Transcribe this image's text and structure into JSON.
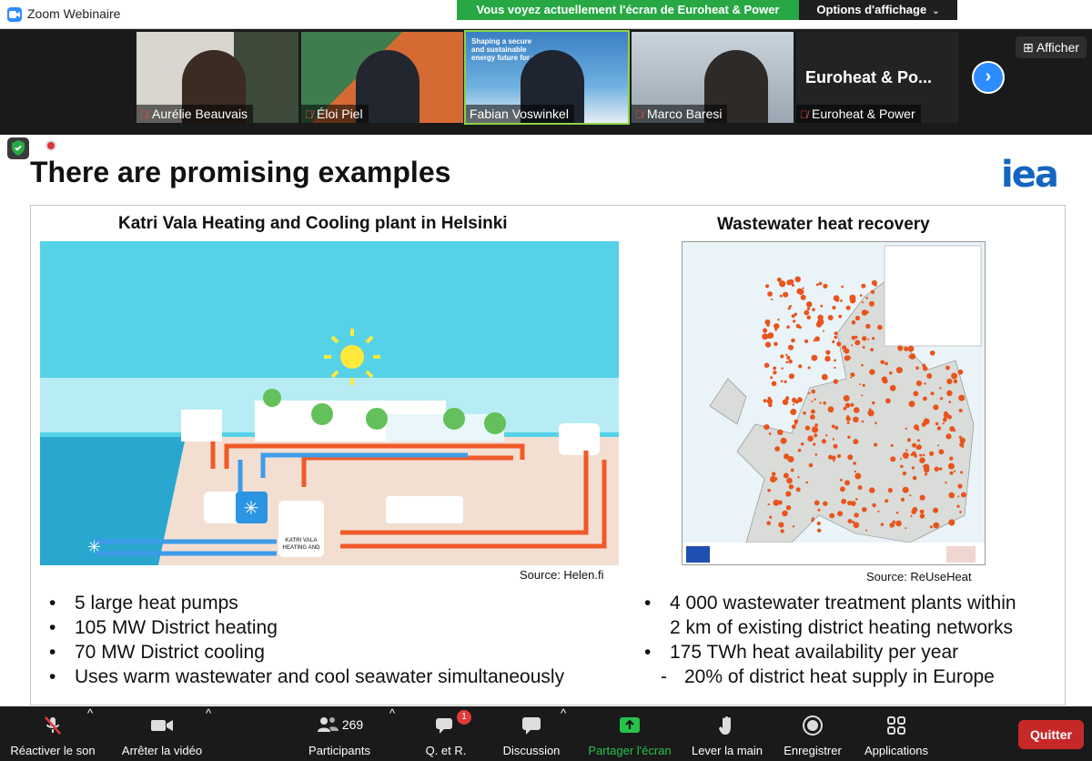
{
  "window": {
    "title": "Zoom Webinaire",
    "share_banner": "Vous voyez actuellement l'écran de Euroheat & Power",
    "view_options": "Options d'affichage"
  },
  "participants_strip": {
    "tiles": [
      {
        "name": "Aurélie Beauvais",
        "muted": true
      },
      {
        "name": "Éloi Piel",
        "muted": true
      },
      {
        "name": "Fabian Voswinkel",
        "muted": false,
        "background_text": "Shaping a secure and sustainable energy future for all."
      },
      {
        "name": "Marco Baresi",
        "muted": true
      },
      {
        "name": "Euroheat & Power",
        "muted": true,
        "display": "Euroheat & Po..."
      }
    ],
    "next_label": "›",
    "show_button": "Afficher"
  },
  "slide": {
    "title": "There are promising examples",
    "logo": "iea",
    "left": {
      "heading": "Katri Vala Heating and Cooling plant in Helsinki",
      "source": "Source: Helen.fi",
      "plant_label": "KATRI VALA HEATING AND COOLING PLANT",
      "bullets": [
        "5 large heat pumps",
        "105 MW District heating",
        "70 MW District cooling",
        "Uses warm wastewater and cool seawater simultaneously"
      ]
    },
    "right": {
      "heading": "Wastewater heat recovery",
      "source": "Source: ReUseHeat",
      "bullets": [
        {
          "text": "4 000 wastewater treatment plants within",
          "type": "bullet"
        },
        {
          "text": "2 km of existing district heating networks",
          "type": "cont"
        },
        {
          "text": "175 TWh heat availability per year",
          "type": "bullet"
        },
        {
          "text": "20% of district heat supply in Europe",
          "type": "sub"
        }
      ]
    }
  },
  "toolbar": {
    "unmute": "Réactiver le son",
    "stop_video": "Arrêter la vidéo",
    "participants": "Participants",
    "participants_count": "269",
    "qa": "Q. et R.",
    "qa_badge": "1",
    "discussion": "Discussion",
    "share_screen": "Partager l'écran",
    "raise_hand": "Lever la main",
    "record": "Enregistrer",
    "apps": "Applications",
    "quit": "Quitter"
  },
  "colors": {
    "share_green": "#27a844",
    "zoom_blue": "#2d8cff",
    "iea_blue": "#1565c0",
    "quit_red": "#c62828",
    "map_dots": "#e8541c"
  }
}
